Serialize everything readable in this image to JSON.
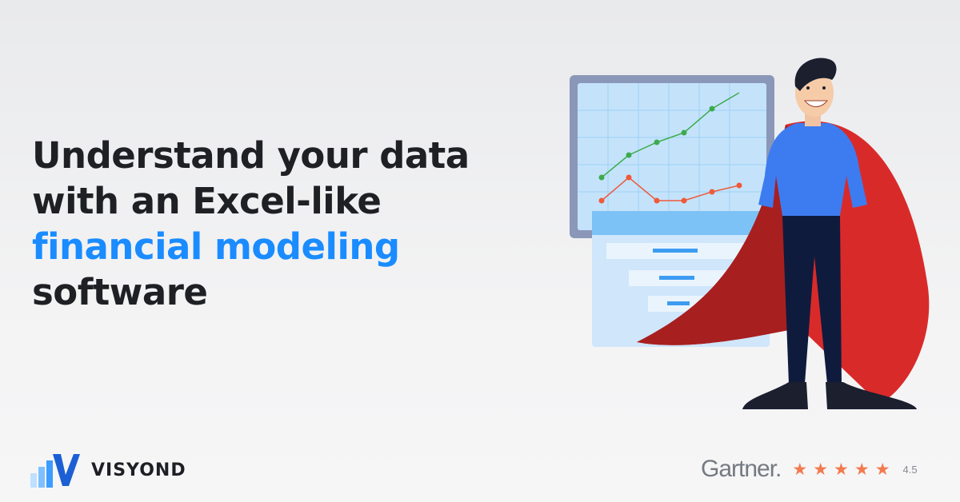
{
  "headline": {
    "line1": "Understand your data",
    "line2": "with an Excel-like",
    "line3": "financial modeling",
    "line4": "software",
    "accent_color": "#1a8cff"
  },
  "logo": {
    "text": "VISYOND",
    "icon": "visyond-logo-icon"
  },
  "rating": {
    "brand": "Gartner.",
    "stars": 5,
    "star_color": "#f37a4e",
    "score": "4.5"
  },
  "illustration": {
    "subject": "superhero-with-chart-illustration",
    "cape_color": "#d92a2a",
    "shirt_color": "#3d7cf0",
    "green_series_color": "#3dab4d",
    "red_series_color": "#ef5a3a"
  }
}
